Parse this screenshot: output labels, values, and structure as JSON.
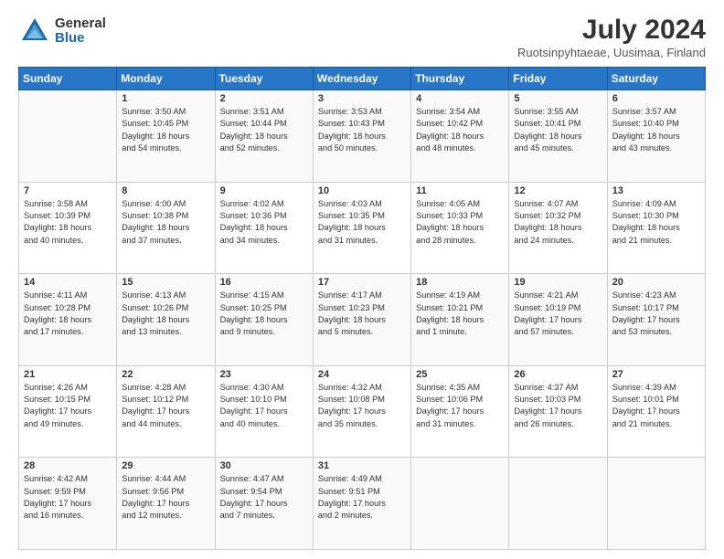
{
  "logo": {
    "general": "General",
    "blue": "Blue"
  },
  "title": "July 2024",
  "subtitle": "Ruotsinpyhtaeae, Uusimaa, Finland",
  "header_days": [
    "Sunday",
    "Monday",
    "Tuesday",
    "Wednesday",
    "Thursday",
    "Friday",
    "Saturday"
  ],
  "weeks": [
    [
      {
        "day": "",
        "info": ""
      },
      {
        "day": "1",
        "info": "Sunrise: 3:50 AM\nSunset: 10:45 PM\nDaylight: 18 hours\nand 54 minutes."
      },
      {
        "day": "2",
        "info": "Sunrise: 3:51 AM\nSunset: 10:44 PM\nDaylight: 18 hours\nand 52 minutes."
      },
      {
        "day": "3",
        "info": "Sunrise: 3:53 AM\nSunset: 10:43 PM\nDaylight: 18 hours\nand 50 minutes."
      },
      {
        "day": "4",
        "info": "Sunrise: 3:54 AM\nSunset: 10:42 PM\nDaylight: 18 hours\nand 48 minutes."
      },
      {
        "day": "5",
        "info": "Sunrise: 3:55 AM\nSunset: 10:41 PM\nDaylight: 18 hours\nand 45 minutes."
      },
      {
        "day": "6",
        "info": "Sunrise: 3:57 AM\nSunset: 10:40 PM\nDaylight: 18 hours\nand 43 minutes."
      }
    ],
    [
      {
        "day": "7",
        "info": "Sunrise: 3:58 AM\nSunset: 10:39 PM\nDaylight: 18 hours\nand 40 minutes."
      },
      {
        "day": "8",
        "info": "Sunrise: 4:00 AM\nSunset: 10:38 PM\nDaylight: 18 hours\nand 37 minutes."
      },
      {
        "day": "9",
        "info": "Sunrise: 4:02 AM\nSunset: 10:36 PM\nDaylight: 18 hours\nand 34 minutes."
      },
      {
        "day": "10",
        "info": "Sunrise: 4:03 AM\nSunset: 10:35 PM\nDaylight: 18 hours\nand 31 minutes."
      },
      {
        "day": "11",
        "info": "Sunrise: 4:05 AM\nSunset: 10:33 PM\nDaylight: 18 hours\nand 28 minutes."
      },
      {
        "day": "12",
        "info": "Sunrise: 4:07 AM\nSunset: 10:32 PM\nDaylight: 18 hours\nand 24 minutes."
      },
      {
        "day": "13",
        "info": "Sunrise: 4:09 AM\nSunset: 10:30 PM\nDaylight: 18 hours\nand 21 minutes."
      }
    ],
    [
      {
        "day": "14",
        "info": "Sunrise: 4:11 AM\nSunset: 10:28 PM\nDaylight: 18 hours\nand 17 minutes."
      },
      {
        "day": "15",
        "info": "Sunrise: 4:13 AM\nSunset: 10:26 PM\nDaylight: 18 hours\nand 13 minutes."
      },
      {
        "day": "16",
        "info": "Sunrise: 4:15 AM\nSunset: 10:25 PM\nDaylight: 18 hours\nand 9 minutes."
      },
      {
        "day": "17",
        "info": "Sunrise: 4:17 AM\nSunset: 10:23 PM\nDaylight: 18 hours\nand 5 minutes."
      },
      {
        "day": "18",
        "info": "Sunrise: 4:19 AM\nSunset: 10:21 PM\nDaylight: 18 hours\nand 1 minute."
      },
      {
        "day": "19",
        "info": "Sunrise: 4:21 AM\nSunset: 10:19 PM\nDaylight: 17 hours\nand 57 minutes."
      },
      {
        "day": "20",
        "info": "Sunrise: 4:23 AM\nSunset: 10:17 PM\nDaylight: 17 hours\nand 53 minutes."
      }
    ],
    [
      {
        "day": "21",
        "info": "Sunrise: 4:26 AM\nSunset: 10:15 PM\nDaylight: 17 hours\nand 49 minutes."
      },
      {
        "day": "22",
        "info": "Sunrise: 4:28 AM\nSunset: 10:12 PM\nDaylight: 17 hours\nand 44 minutes."
      },
      {
        "day": "23",
        "info": "Sunrise: 4:30 AM\nSunset: 10:10 PM\nDaylight: 17 hours\nand 40 minutes."
      },
      {
        "day": "24",
        "info": "Sunrise: 4:32 AM\nSunset: 10:08 PM\nDaylight: 17 hours\nand 35 minutes."
      },
      {
        "day": "25",
        "info": "Sunrise: 4:35 AM\nSunset: 10:06 PM\nDaylight: 17 hours\nand 31 minutes."
      },
      {
        "day": "26",
        "info": "Sunrise: 4:37 AM\nSunset: 10:03 PM\nDaylight: 17 hours\nand 26 minutes."
      },
      {
        "day": "27",
        "info": "Sunrise: 4:39 AM\nSunset: 10:01 PM\nDaylight: 17 hours\nand 21 minutes."
      }
    ],
    [
      {
        "day": "28",
        "info": "Sunrise: 4:42 AM\nSunset: 9:59 PM\nDaylight: 17 hours\nand 16 minutes."
      },
      {
        "day": "29",
        "info": "Sunrise: 4:44 AM\nSunset: 9:56 PM\nDaylight: 17 hours\nand 12 minutes."
      },
      {
        "day": "30",
        "info": "Sunrise: 4:47 AM\nSunset: 9:54 PM\nDaylight: 17 hours\nand 7 minutes."
      },
      {
        "day": "31",
        "info": "Sunrise: 4:49 AM\nSunset: 9:51 PM\nDaylight: 17 hours\nand 2 minutes."
      },
      {
        "day": "",
        "info": ""
      },
      {
        "day": "",
        "info": ""
      },
      {
        "day": "",
        "info": ""
      }
    ]
  ]
}
